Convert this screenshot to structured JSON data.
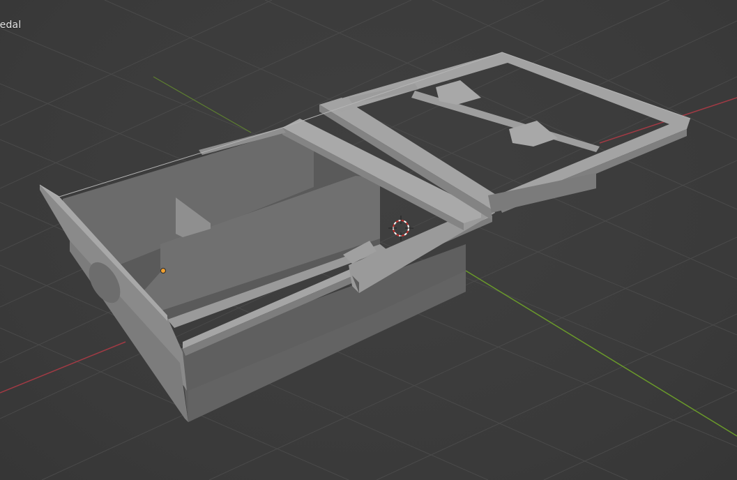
{
  "viewport": {
    "object_name_label": "redal"
  },
  "colors": {
    "background": "#3d3d3d",
    "grid_line": "#4a4a4a",
    "x_axis": "#a13a44",
    "y_axis": "#6a9a2a",
    "mesh_light": "#a3a3a3",
    "mesh_mid": "#8e8e8e",
    "mesh_dark": "#5a5a5a",
    "mesh_inner": "#676767",
    "origin_dot": "#f0a030"
  },
  "icons": {
    "cursor": "3d-cursor-icon",
    "origin": "object-origin-icon"
  }
}
